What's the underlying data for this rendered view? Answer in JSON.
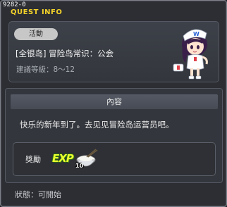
{
  "window": {
    "id": "9282-0",
    "title": "QUEST INFO"
  },
  "quest": {
    "category": "活動",
    "name": "[全银岛] 冒险岛常识：公会",
    "level": "建議等級：8～12"
  },
  "content": {
    "header": "內容",
    "text": "快乐的新年到了。去见见冒险岛运营员吧。"
  },
  "reward": {
    "label": "獎勵",
    "items": [
      {
        "icon": "exp-icon",
        "text": "EXP"
      },
      {
        "icon": "rice-bowl-icon",
        "quantity": "10"
      }
    ]
  },
  "status": "狀態：可開始",
  "colors": {
    "title": "#f4d22a",
    "background": "#2c2e33",
    "panel": "#3d4149"
  }
}
